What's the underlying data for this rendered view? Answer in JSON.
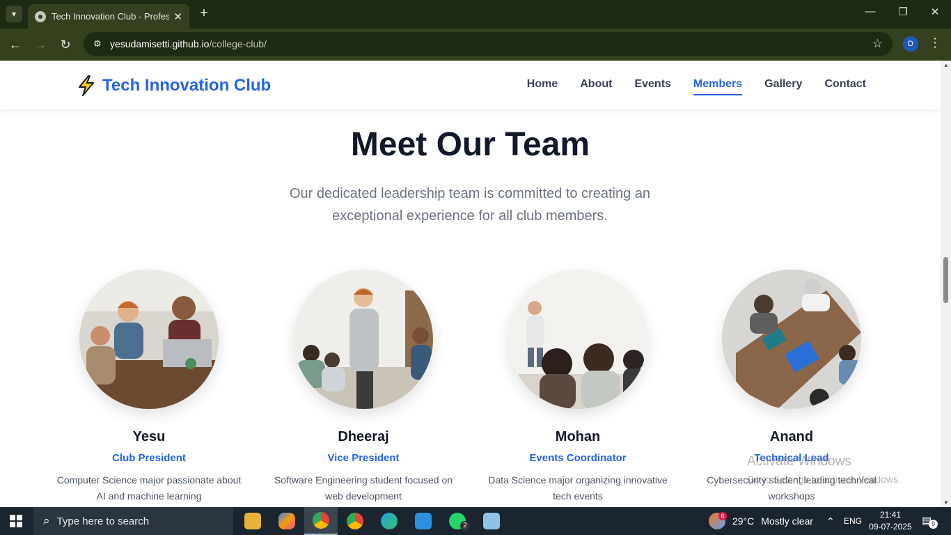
{
  "browser": {
    "tab_title": "Tech Innovation Club - Professi",
    "url_host": "yesudamisetti.github.io",
    "url_path": "/college-club/",
    "profile_initial": "D"
  },
  "site": {
    "logo_text": "Tech Innovation Club",
    "nav": [
      {
        "label": "Home",
        "active": false
      },
      {
        "label": "About",
        "active": false
      },
      {
        "label": "Events",
        "active": false
      },
      {
        "label": "Members",
        "active": true
      },
      {
        "label": "Gallery",
        "active": false
      },
      {
        "label": "Contact",
        "active": false
      }
    ],
    "accent_color": "#2563eb"
  },
  "team": {
    "title": "Meet Our Team",
    "subtitle": "Our dedicated leadership team is committed to creating an exceptional experience for all club members.",
    "members": [
      {
        "name": "Yesu",
        "role": "Club President",
        "description": "Computer Science major passionate about AI and machine learning"
      },
      {
        "name": "Dheeraj",
        "role": "Vice President",
        "description": "Software Engineering student focused on web development"
      },
      {
        "name": "Mohan",
        "role": "Events Coordinator",
        "description": "Data Science major organizing innovative tech events"
      },
      {
        "name": "Anand",
        "role": "Technical Lead",
        "description": "Cybersecurity student leading technical workshops"
      }
    ]
  },
  "watermark": {
    "line1": "Activate Windows",
    "line2": "Go to Settings to activate Windows."
  },
  "taskbar": {
    "search_placeholder": "Type here to search",
    "weather_temp": "29°C",
    "weather_text": "Mostly clear",
    "weather_badge": "6",
    "language": "ENG",
    "time": "21:41",
    "date": "09-07-2025",
    "whatsapp_badge": "2",
    "notification_count": "9"
  }
}
